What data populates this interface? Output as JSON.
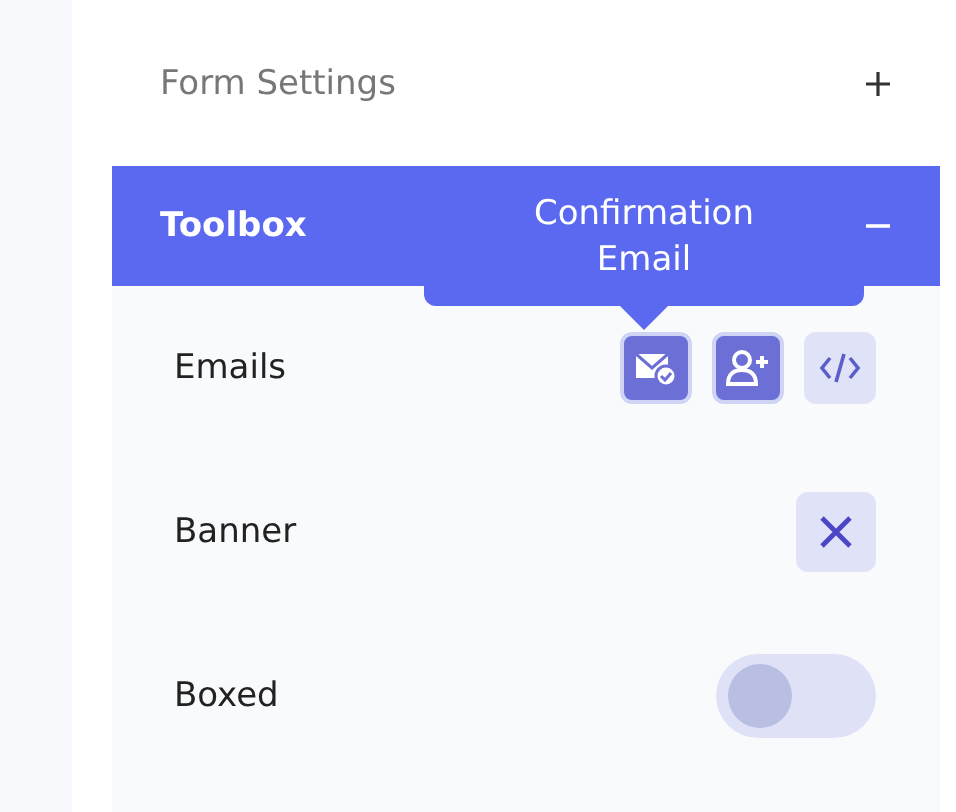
{
  "form_settings": {
    "title": "Form Settings",
    "expanded": false
  },
  "toolbox": {
    "title": "Toolbox",
    "expanded": true
  },
  "tooltip": {
    "text": "Confirmation Email"
  },
  "rows": [
    {
      "kind": "icons",
      "label": "Emails",
      "icons": [
        {
          "kind": "mail",
          "selected": true
        },
        {
          "kind": "user",
          "selected": true
        },
        {
          "kind": "code",
          "selected": false
        }
      ]
    },
    {
      "kind": "button",
      "label": "Banner"
    },
    {
      "kind": "toggle",
      "label": "Boxed",
      "on": false
    }
  ]
}
